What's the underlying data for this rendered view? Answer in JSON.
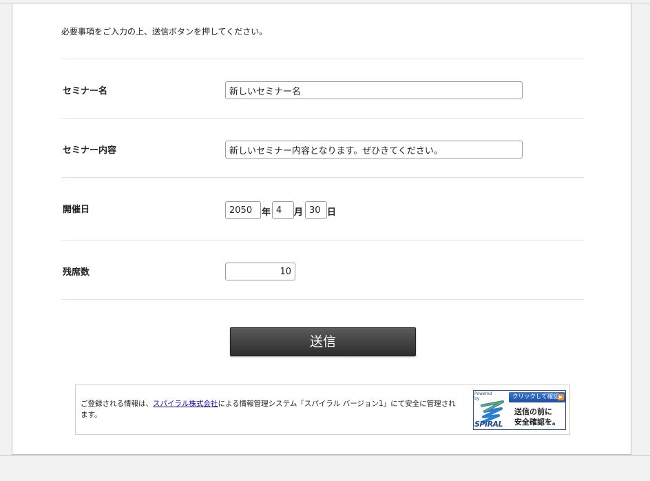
{
  "intro_text": "必要事項をご入力の上、送信ボタンを押してください。",
  "fields": {
    "seminar_name": {
      "label": "セミナー名",
      "value": "新しいセミナー名"
    },
    "seminar_content": {
      "label": "セミナー内容",
      "value": "新しいセミナー内容となります。ぜひきてください。"
    },
    "event_date": {
      "label": "開催日",
      "year": "2050",
      "year_unit": "年",
      "month": "4",
      "month_unit": "月",
      "day": "30",
      "day_unit": "日"
    },
    "remaining_seats": {
      "label": "残席数",
      "value": "10"
    }
  },
  "submit_label": "送信",
  "notice": {
    "prefix": "ご登録される情報は、",
    "link_text": "スパイラル株式会社",
    "suffix": "による情報管理システム「スパイラル バージョン1」にて安全に管理されます。"
  },
  "badge": {
    "powered_by": "Powered by",
    "button_text": "クリックして確認",
    "line1": "送信の前に",
    "line2": "安全確認を。",
    "wordmark": "SPIRAL"
  },
  "colors": {
    "button_bg": "#3a3a3a",
    "link": "#1a0dab",
    "badge_blue": "#2a4e8c",
    "badge_orange": "#f28a1a"
  }
}
